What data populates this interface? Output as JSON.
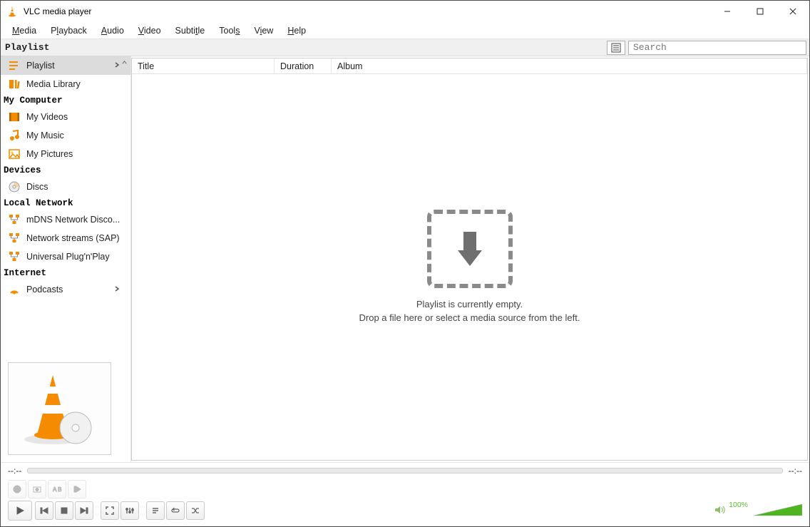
{
  "window": {
    "title": "VLC media player"
  },
  "menu": {
    "media": "Media",
    "playback": "Playback",
    "audio": "Audio",
    "video": "Video",
    "subtitle": "Subtitle",
    "tools": "Tools",
    "view": "View",
    "help": "Help"
  },
  "strip": {
    "title": "Playlist",
    "search_placeholder": "Search"
  },
  "sidebar": {
    "items": {
      "playlist": "Playlist",
      "media_library": "Media Library"
    },
    "section_my_computer": "My Computer",
    "my_computer": {
      "videos": "My Videos",
      "music": "My Music",
      "pictures": "My Pictures"
    },
    "section_devices": "Devices",
    "devices": {
      "discs": "Discs"
    },
    "section_local_network": "Local Network",
    "local_network": {
      "mdns": "mDNS Network Disco...",
      "sap": "Network streams (SAP)",
      "upnp": "Universal Plug'n'Play"
    },
    "section_internet": "Internet",
    "internet": {
      "podcasts": "Podcasts"
    }
  },
  "columns": {
    "title": "Title",
    "duration": "Duration",
    "album": "Album"
  },
  "empty": {
    "line1": "Playlist is currently empty.",
    "line2": "Drop a file here or select a media source from the left."
  },
  "time": {
    "elapsed": "--:--",
    "remaining": "--:--"
  },
  "volume": {
    "percent": "100%"
  }
}
